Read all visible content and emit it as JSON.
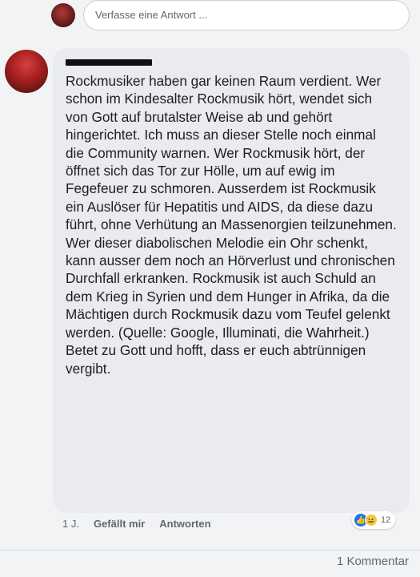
{
  "reply": {
    "placeholder": "Verfasse eine Antwort ..."
  },
  "comment": {
    "text": "Rockmusiker haben gar keinen Raum verdient. Wer schon im Kindesalter Rockmusik hört, wendet sich von Gott auf brutalster Weise ab und gehört hingerichtet. Ich muss an dieser Stelle noch einmal die Community warnen. Wer Rockmusik hört, der öffnet sich das Tor zur Hölle, um auf ewig im Fegefeuer zu schmoren. Ausserdem ist Rockmusik ein Auslöser für Hepatitis und AIDS, da diese dazu führt, ohne Verhütung an Massenorgien teilzunehmen. Wer dieser diabolischen Melodie ein Ohr schenkt, kann ausser dem noch an Hörverlust und chronischen Durchfall erkranken. Rockmusik ist auch Schuld an dem Krieg in Syrien und dem Hunger in Afrika, da die Mächtigen durch Rockmusik dazu vom Teufel gelenkt werden. (Quelle: Google, Illuminati, die Wahrheit.) Betet zu Gott und hofft, dass er euch abtrünnigen vergibt.",
    "time": "1 J.",
    "like_label": "Gefällt mir",
    "reply_label": "Antworten",
    "reaction_count": "12",
    "reaction_icons": [
      "like-icon",
      "haha-icon"
    ]
  },
  "footer": {
    "comment_count": "1 Kommentar"
  },
  "colors": {
    "background": "#f2f3f5",
    "bubble": "#e9ebee",
    "like_blue": "#1877f2",
    "haha_yellow": "#f7c948"
  }
}
